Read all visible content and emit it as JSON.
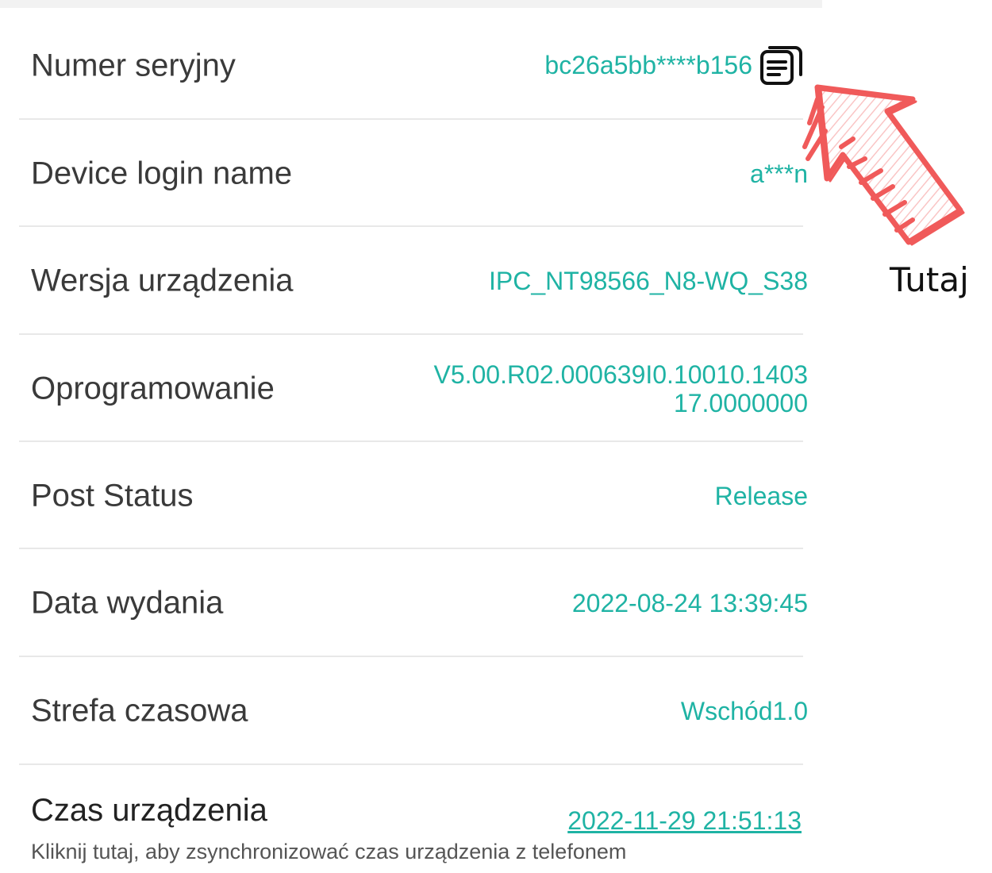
{
  "rows": [
    {
      "label": "Numer seryjny",
      "value": "bc26a5bb****b156"
    },
    {
      "label": "Device login name",
      "value": "a***n"
    },
    {
      "label": "Wersja urządzenia",
      "value": "IPC_NT98566_N8-WQ_S38"
    },
    {
      "label": "Oprogramowanie",
      "value": "V5.00.R02.000639I0.10010.1403",
      "value_line2": "17.0000000"
    },
    {
      "label": "Post Status",
      "value": "Release"
    },
    {
      "label": "Data wydania",
      "value": "2022-08-24 13:39:45"
    },
    {
      "label": "Strefa czasowa",
      "value": "Wschód1.0"
    }
  ],
  "device_time": {
    "label": "Czas urządzenia",
    "value": "2022-11-29 21:51:13",
    "hint": "Kliknij tutaj, aby zsynchronizować czas urządzenia z telefonem"
  },
  "annotation": {
    "text": "Tutaj",
    "color": "#f05a5a"
  },
  "colors": {
    "accent": "#1fb3a4",
    "label": "#3a3a3a"
  },
  "icons": {
    "copy": "copy-icon",
    "annotation_arrow": "hand-drawn-arrow-icon"
  }
}
